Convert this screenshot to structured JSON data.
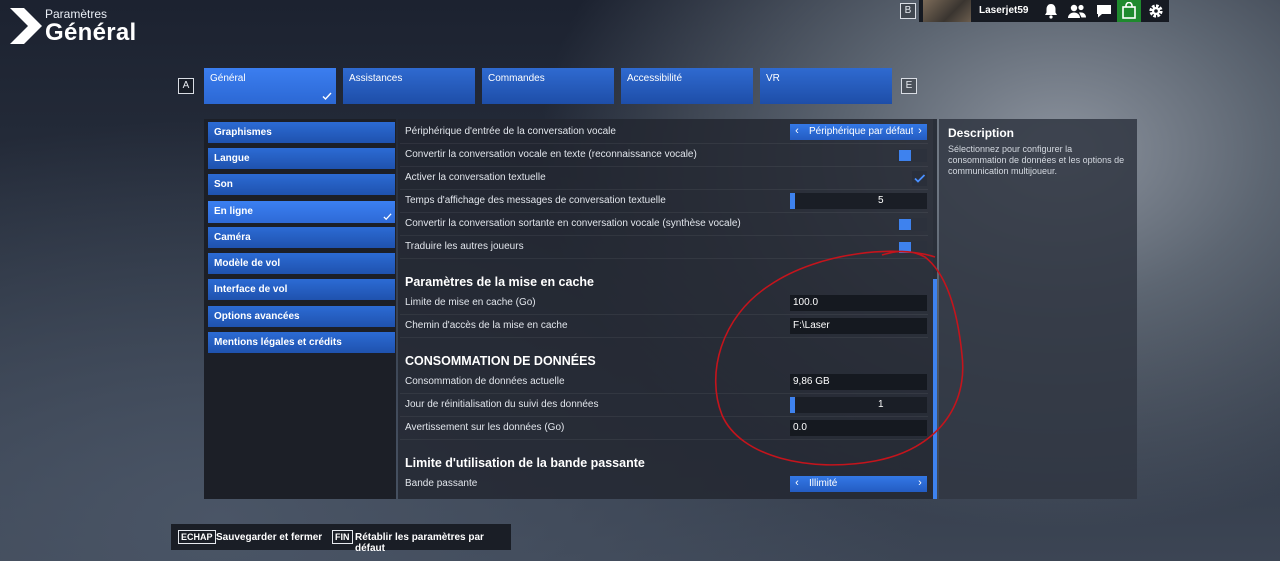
{
  "header": {
    "breadcrumb": "Paramètres",
    "title": "Général",
    "key_left_top": "B"
  },
  "user": {
    "name": "Laserjet59",
    "icons": [
      "bell-icon",
      "friends-icon",
      "chat-icon",
      "store-icon",
      "gear-icon"
    ]
  },
  "tabs": {
    "key_prev": "A",
    "key_next": "E",
    "items": [
      {
        "label": "Général",
        "active": true
      },
      {
        "label": "Assistances"
      },
      {
        "label": "Commandes"
      },
      {
        "label": "Accessibilité"
      },
      {
        "label": "VR"
      }
    ]
  },
  "menu": {
    "items": [
      {
        "label": "Graphismes"
      },
      {
        "label": "Langue"
      },
      {
        "label": "Son"
      },
      {
        "label": "En ligne",
        "active": true
      },
      {
        "label": "Caméra"
      },
      {
        "label": "Modèle de vol"
      },
      {
        "label": "Interface de vol"
      },
      {
        "label": "Options avancées"
      },
      {
        "label": "Mentions légales et crédits"
      }
    ]
  },
  "settings": {
    "voice_input": {
      "label": "Périphérique d'entrée de la conversation vocale",
      "value": "Périphérique par défaut -"
    },
    "voice_to_text": {
      "label": "Convertir la conversation vocale en texte (reconnaissance vocale)"
    },
    "text_chat": {
      "label": "Activer la conversation textuelle"
    },
    "text_display_time": {
      "label": "Temps d'affichage des messages de conversation textuelle",
      "value": "5"
    },
    "outgoing_tts": {
      "label": "Convertir la conversation sortante en conversation vocale (synthèse vocale)"
    },
    "translate_players": {
      "label": "Traduire les autres joueurs"
    },
    "cache_section": "Paramètres de la mise en cache",
    "cache_limit": {
      "label": "Limite de mise en cache (Go)",
      "value": "100.0"
    },
    "cache_path": {
      "label": "Chemin d'accès de la mise en cache",
      "value": "F:\\Laser"
    },
    "data_section": "CONSOMMATION DE DONNÉES",
    "data_current": {
      "label": "Consommation de données actuelle",
      "value": "9,86 GB"
    },
    "data_reset_day": {
      "label": "Jour de réinitialisation du suivi des données",
      "value": "1"
    },
    "data_warning": {
      "label": "Avertissement sur les données (Go)",
      "value": "0.0"
    },
    "bandwidth_section": "Limite d'utilisation de la bande passante",
    "bandwidth": {
      "label": "Bande passante",
      "value": "Illimité"
    }
  },
  "description": {
    "title": "Description",
    "text": "Sélectionnez pour configurer la consommation de données et les options de communication multijoueur."
  },
  "footer": {
    "save_key": "ECHAP",
    "save_label": "Sauvegarder et fermer",
    "reset_key": "FIN",
    "reset_label": "Rétablir les paramètres par défaut"
  },
  "colors": {
    "accent": "#3e82ee",
    "tab_blue": "#1e4ea8",
    "annotation": "#c4141c",
    "store_green": "#1f8a2e"
  }
}
